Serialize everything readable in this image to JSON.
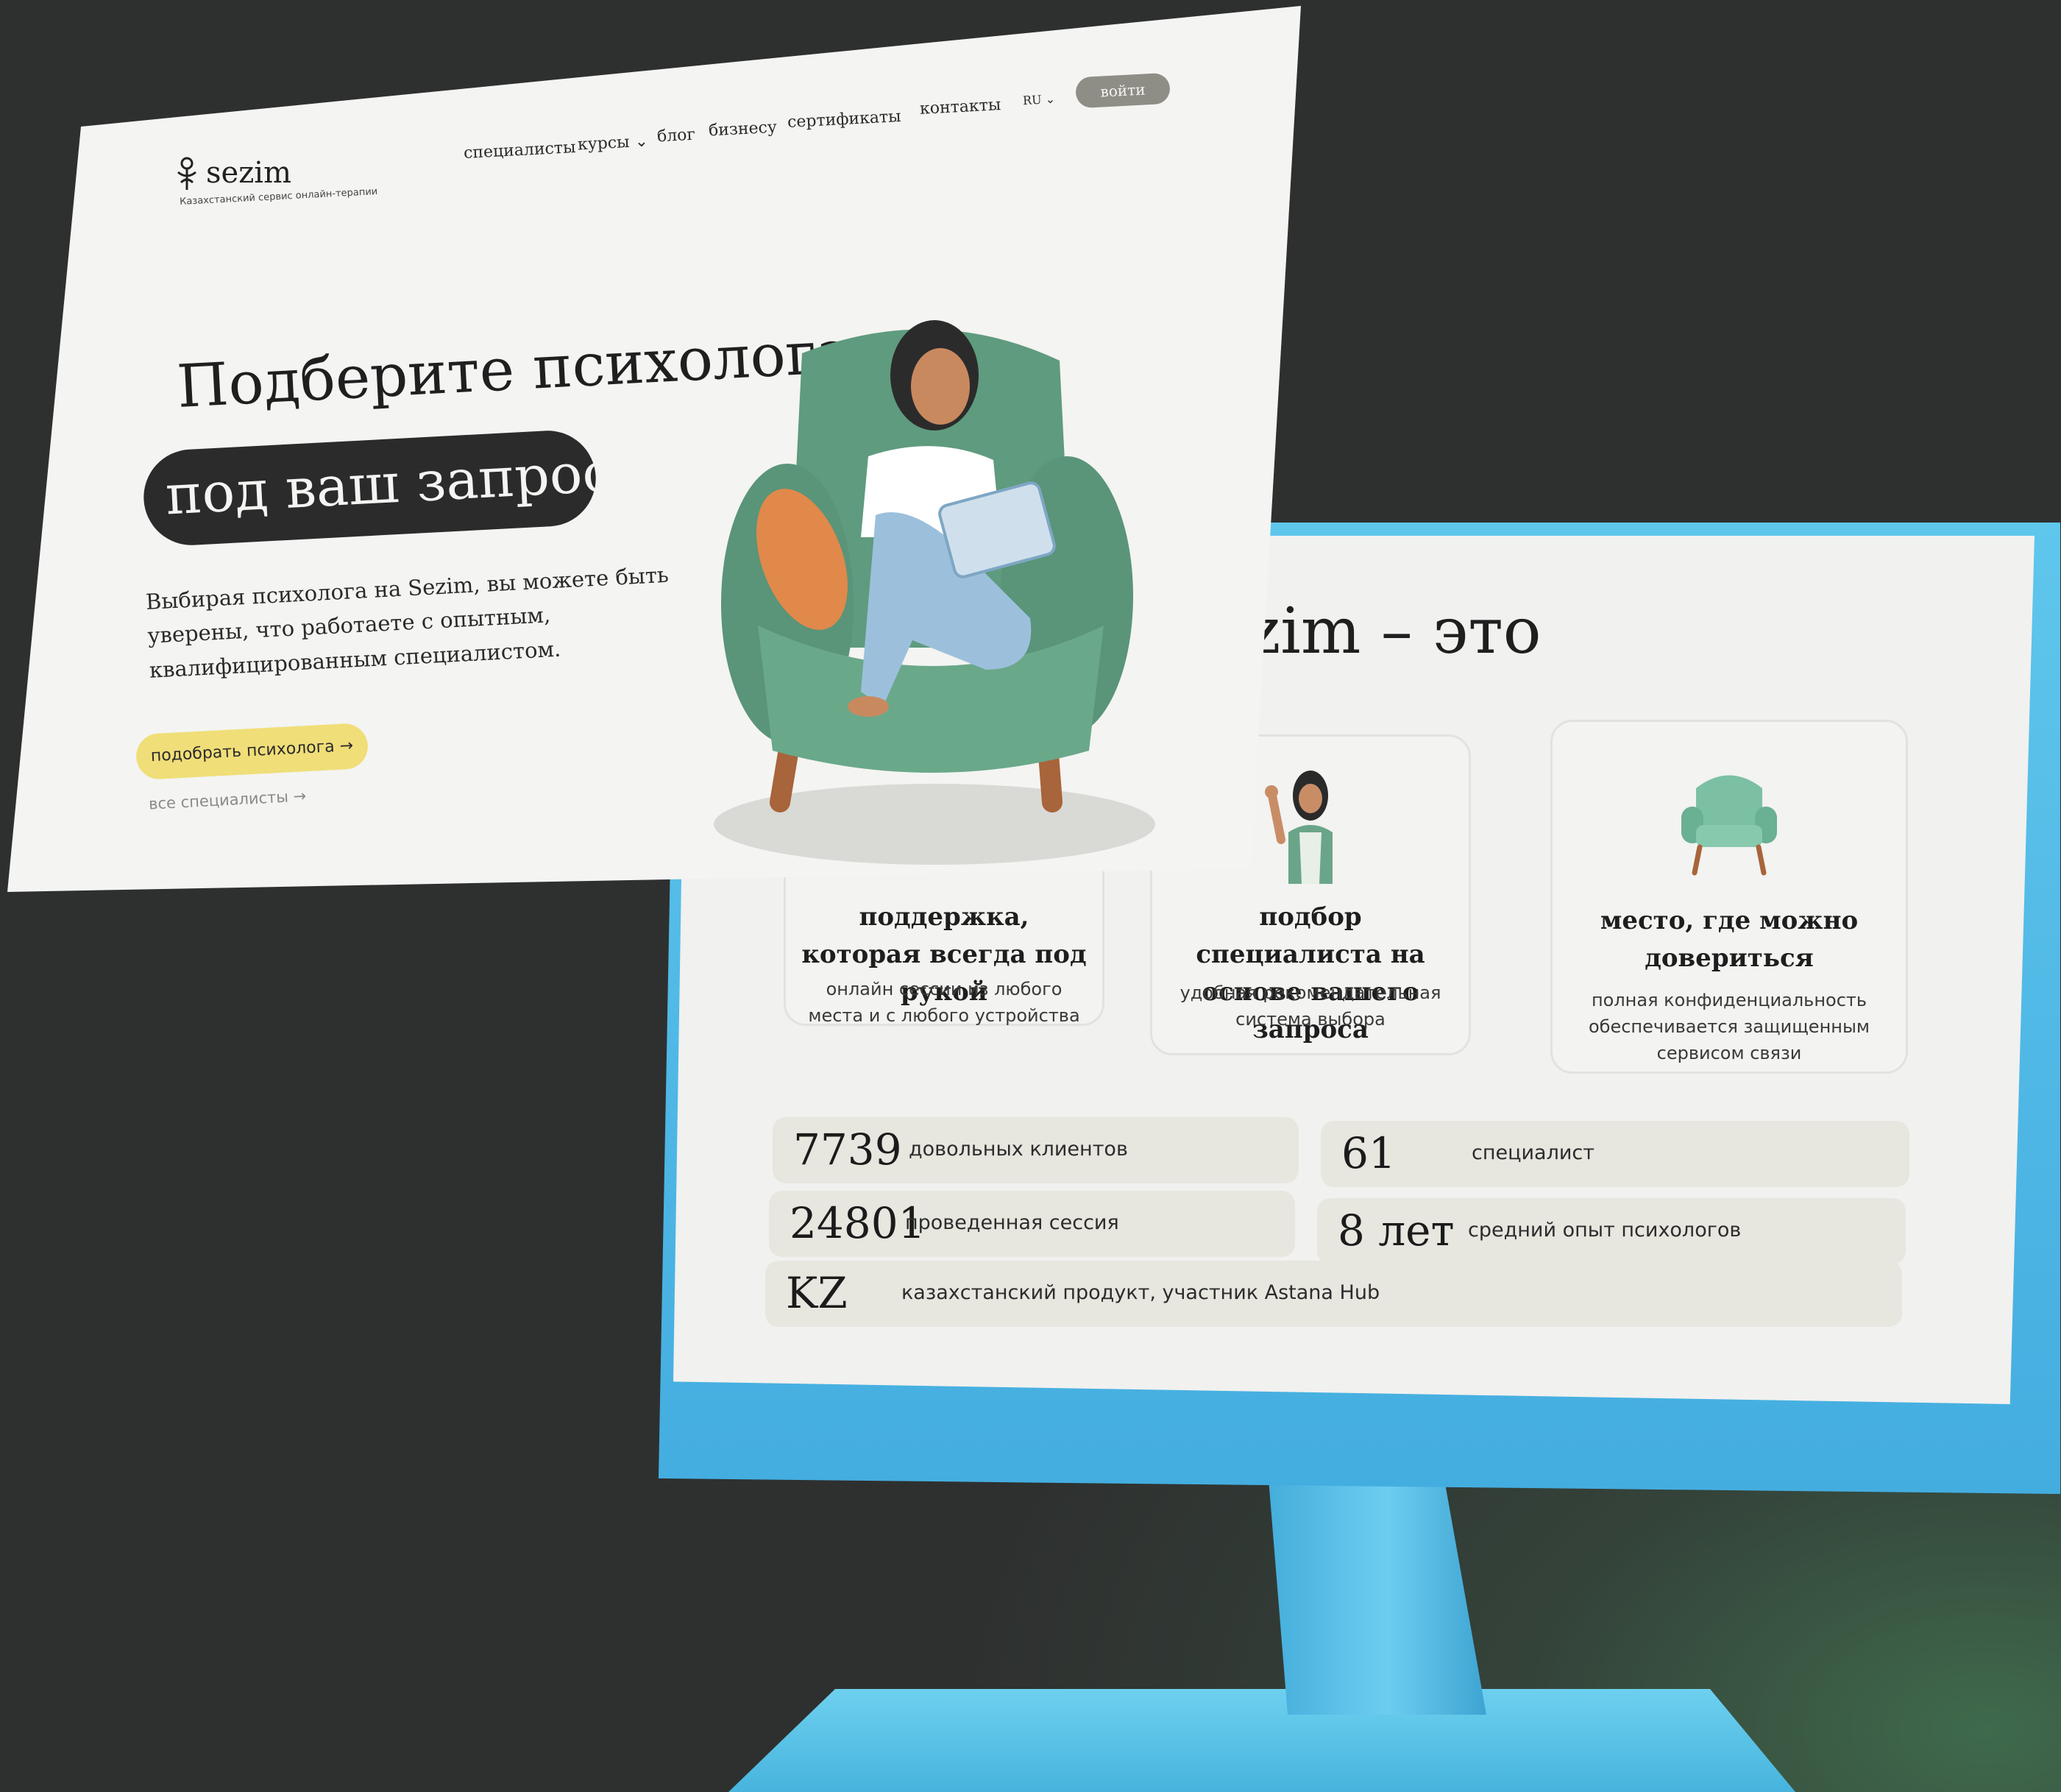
{
  "landing": {
    "logo": {
      "text": "sezim",
      "tagline": "Казахстанский сервис онлайн-терапии"
    },
    "nav": {
      "specialists": "специалисты",
      "courses": "курсы ⌄",
      "blog": "блог",
      "business": "бизнесу",
      "certificates": "сертификаты",
      "contacts": "контакты",
      "language": "RU ⌄",
      "login": "войти"
    },
    "hero": {
      "title": "Подберите психолога",
      "pill": "под ваш запрос",
      "description": "Выбирая психолога на Sezim, вы можете быть уверены, что работаете с опытным, квалифицированным специалистом.",
      "cta": "подобрать психолога →",
      "secondary_link": "все специалисты →"
    }
  },
  "monitor": {
    "section_title": "zim – это",
    "cards": [
      {
        "title": "поддержка, которая всегда под рукой",
        "description": "онлайн сессии из любого места и с любого устройства"
      },
      {
        "title": "подбор специалиста на основе вашего запроса",
        "description": "удобная рекомендательная система выбора"
      },
      {
        "title": "место, где можно довериться",
        "description": "полная конфиденциальность обеспечивается защищенным сервисом связи"
      }
    ],
    "stats": [
      {
        "value": "7739",
        "label": "довольных клиентов"
      },
      {
        "value": "61",
        "label": "специалист"
      },
      {
        "value": "24801",
        "label": "проведенная сессия"
      },
      {
        "value": "8 лет",
        "label": "средний опыт психологов"
      },
      {
        "value": "KZ",
        "label": "казахстанский продукт, участник Astana Hub"
      }
    ]
  },
  "colors": {
    "monitor_blue": "#5fc6ec",
    "cta_yellow": "#f0de78",
    "pill_dark": "#2b2b2b",
    "armchair_green": "#5f9b7e"
  }
}
